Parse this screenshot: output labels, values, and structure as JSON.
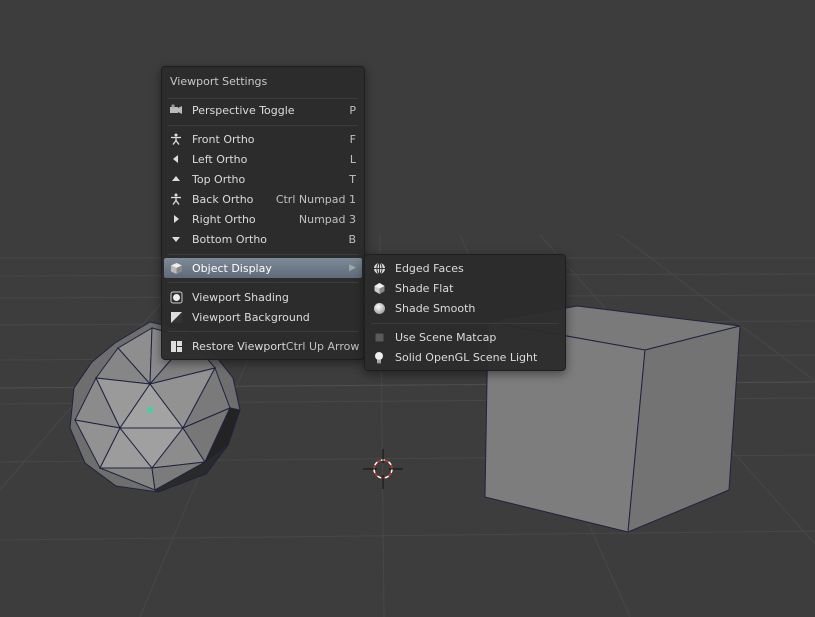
{
  "menu": {
    "title": "Viewport Settings",
    "items": {
      "perspective_toggle": {
        "label": "Perspective Toggle",
        "shortcut": "P",
        "icon": "camera-icon"
      },
      "front_ortho": {
        "label": "Front Ortho",
        "shortcut": "F",
        "icon": "figure-icon"
      },
      "left_ortho": {
        "label": "Left Ortho",
        "shortcut": "L",
        "icon": "triangle-left-icon"
      },
      "top_ortho": {
        "label": "Top Ortho",
        "shortcut": "T",
        "icon": "triangle-up-icon"
      },
      "back_ortho": {
        "label": "Back Ortho",
        "shortcut": "Ctrl Numpad 1",
        "icon": "figure-icon"
      },
      "right_ortho": {
        "label": "Right Ortho",
        "shortcut": "Numpad 3",
        "icon": "triangle-right-icon"
      },
      "bottom_ortho": {
        "label": "Bottom Ortho",
        "shortcut": "B",
        "icon": "triangle-down-icon"
      },
      "object_display": {
        "label": "Object Display",
        "icon": "cube-icon"
      },
      "viewport_shading": {
        "label": "Viewport Shading",
        "icon": "shading-icon"
      },
      "viewport_background": {
        "label": "Viewport Background",
        "icon": "background-icon"
      },
      "restore_viewport": {
        "label": "Restore Viewport",
        "shortcut": "Ctrl Up Arrow",
        "icon": "layout-icon"
      }
    }
  },
  "submenu": {
    "items": {
      "edged_faces": {
        "label": "Edged Faces",
        "icon": "wire-sphere-icon"
      },
      "shade_flat": {
        "label": "Shade Flat",
        "icon": "flat-sphere-icon"
      },
      "shade_smooth": {
        "label": "Shade Smooth",
        "icon": "smooth-sphere-icon"
      },
      "use_scene_matcap": {
        "label": "Use Scene Matcap",
        "icon": "checkbox-icon"
      },
      "solid_opengl_light": {
        "label": "Solid OpenGL Scene Light",
        "icon": "light-bulb-icon"
      }
    }
  },
  "colors": {
    "background": "#3d3d3d",
    "grid": "#474747",
    "menu_bg": "#2c2c2c",
    "highlight": "#6f7b88",
    "cursor": "#d03030"
  }
}
